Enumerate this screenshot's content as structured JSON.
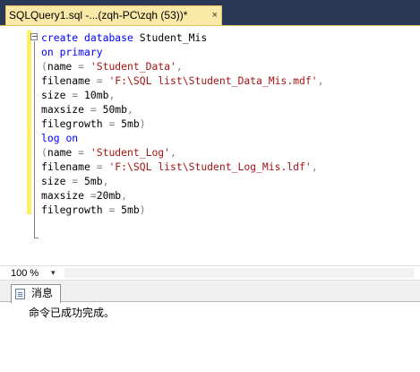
{
  "tab": {
    "title": "SQLQuery1.sql -...(zqh-PC\\zqh (53))*",
    "close": "×"
  },
  "code": {
    "lines": [
      [
        {
          "t": "create",
          "c": "kw"
        },
        {
          "t": " ",
          "c": ""
        },
        {
          "t": "database",
          "c": "kw"
        },
        {
          "t": " Student_Mis",
          "c": ""
        }
      ],
      [
        {
          "t": "on",
          "c": "kw"
        },
        {
          "t": " ",
          "c": ""
        },
        {
          "t": "primary",
          "c": "kw"
        }
      ],
      [
        {
          "t": "(",
          "c": "gray"
        },
        {
          "t": "name ",
          "c": ""
        },
        {
          "t": "=",
          "c": "gray"
        },
        {
          "t": " ",
          "c": ""
        },
        {
          "t": "'Student_Data'",
          "c": "str"
        },
        {
          "t": ",",
          "c": "gray"
        }
      ],
      [
        {
          "t": "filename ",
          "c": ""
        },
        {
          "t": "=",
          "c": "gray"
        },
        {
          "t": " ",
          "c": ""
        },
        {
          "t": "'F:\\SQL list\\Student_Data_Mis.mdf'",
          "c": "str"
        },
        {
          "t": ",",
          "c": "gray"
        }
      ],
      [
        {
          "t": "size ",
          "c": ""
        },
        {
          "t": "=",
          "c": "gray"
        },
        {
          "t": " 10mb",
          "c": ""
        },
        {
          "t": ",",
          "c": "gray"
        }
      ],
      [
        {
          "t": "maxsize ",
          "c": ""
        },
        {
          "t": "=",
          "c": "gray"
        },
        {
          "t": " 50mb",
          "c": ""
        },
        {
          "t": ",",
          "c": "gray"
        }
      ],
      [
        {
          "t": "filegrowth ",
          "c": ""
        },
        {
          "t": "=",
          "c": "gray"
        },
        {
          "t": " 5mb",
          "c": ""
        },
        {
          "t": ")",
          "c": "gray"
        }
      ],
      [
        {
          "t": "log",
          "c": "kw"
        },
        {
          "t": " ",
          "c": ""
        },
        {
          "t": "on",
          "c": "kw"
        }
      ],
      [
        {
          "t": "(",
          "c": "gray"
        },
        {
          "t": "name ",
          "c": ""
        },
        {
          "t": "=",
          "c": "gray"
        },
        {
          "t": " ",
          "c": ""
        },
        {
          "t": "'Student_Log'",
          "c": "str"
        },
        {
          "t": ",",
          "c": "gray"
        }
      ],
      [
        {
          "t": "filename ",
          "c": ""
        },
        {
          "t": "=",
          "c": "gray"
        },
        {
          "t": " ",
          "c": ""
        },
        {
          "t": "'F:\\SQL list\\Student_Log_Mis.ldf'",
          "c": "str"
        },
        {
          "t": ",",
          "c": "gray"
        }
      ],
      [
        {
          "t": "size ",
          "c": ""
        },
        {
          "t": "=",
          "c": "gray"
        },
        {
          "t": " 5mb",
          "c": ""
        },
        {
          "t": ",",
          "c": "gray"
        }
      ],
      [
        {
          "t": "maxsize ",
          "c": ""
        },
        {
          "t": "=",
          "c": "gray"
        },
        {
          "t": "20mb",
          "c": ""
        },
        {
          "t": ",",
          "c": "gray"
        }
      ],
      [
        {
          "t": "filegrowth ",
          "c": ""
        },
        {
          "t": "=",
          "c": "gray"
        },
        {
          "t": " 5mb",
          "c": ""
        },
        {
          "t": ")",
          "c": "gray"
        }
      ]
    ]
  },
  "status": {
    "zoom": "100 %",
    "zoom_arrow": "▾"
  },
  "results": {
    "tab_label": "消息",
    "message": "命令已成功完成。"
  },
  "colors": {
    "keyword": "#0000ff",
    "string": "#a31515",
    "operator": "#808080",
    "chrome": "#293955",
    "active_tab": "#fbe9a8"
  },
  "icons": {
    "tab_close": "close-icon",
    "collapse": "collapse-minus-icon",
    "messages": "message-list-icon"
  }
}
